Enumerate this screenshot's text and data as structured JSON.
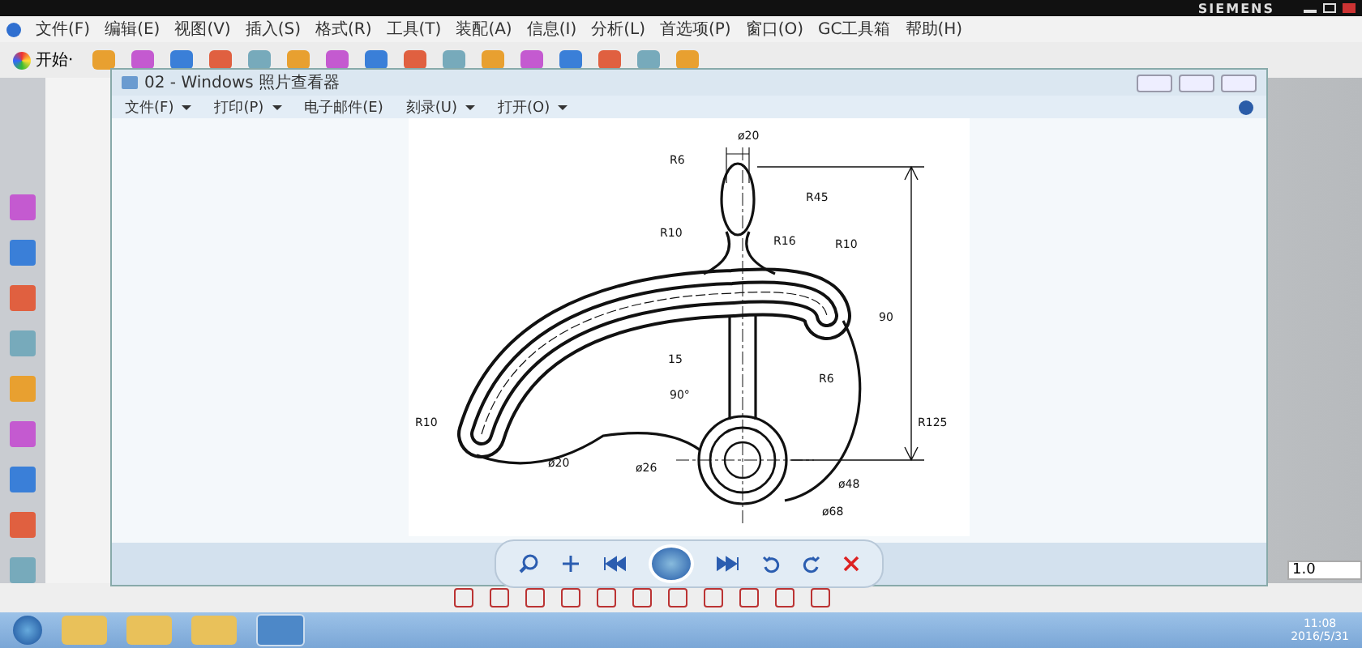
{
  "nx": {
    "brand": "SIEMENS",
    "menu": [
      "文件(F)",
      "编辑(E)",
      "视图(V)",
      "插入(S)",
      "格式(R)",
      "工具(T)",
      "装配(A)",
      "信息(I)",
      "分析(L)",
      "首选项(P)",
      "窗口(O)",
      "GC工具箱",
      "帮助(H)"
    ],
    "start_button": "开始·",
    "scale_field": "1.0"
  },
  "viewer": {
    "title": "02 - Windows 照片查看器",
    "menu": [
      {
        "label": "文件(F)",
        "dropdown": true
      },
      {
        "label": "打印(P)",
        "dropdown": true
      },
      {
        "label": "电子邮件(E)",
        "dropdown": false
      },
      {
        "label": "刻录(U)",
        "dropdown": true
      },
      {
        "label": "打开(O)",
        "dropdown": true
      }
    ],
    "dimension_labels": [
      "R6",
      "ø20",
      "R45",
      "R10",
      "R16",
      "R10",
      "R10",
      "ø20",
      "ø26",
      "15",
      "90°",
      "R6",
      "R125",
      "ø48",
      "ø68",
      "90"
    ]
  },
  "taskbar": {
    "time": "11:08",
    "date": "2016/5/31"
  }
}
